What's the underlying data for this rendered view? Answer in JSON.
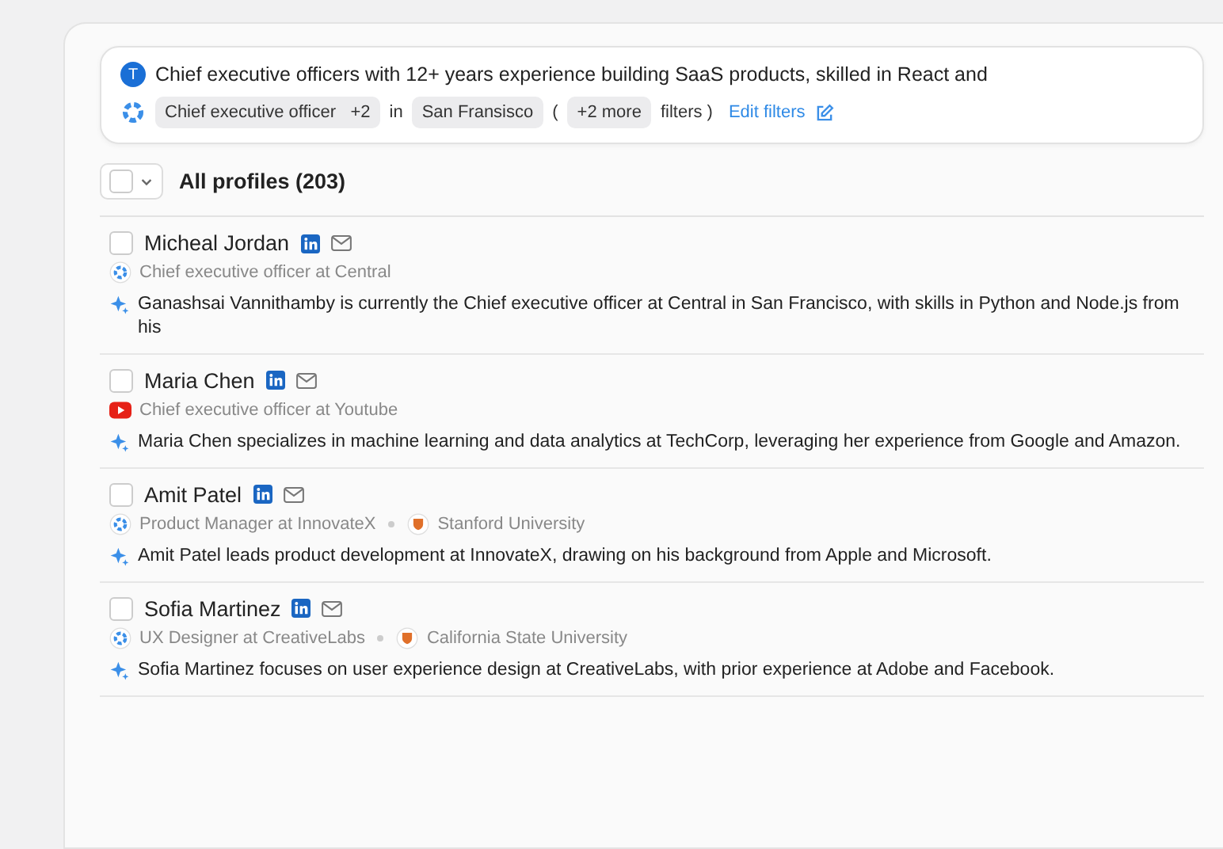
{
  "query": {
    "avatar": "T",
    "text": "Chief executive officers with 12+ years experience building SaaS products, skilled in React and",
    "filters": [
      {
        "kind": "chip",
        "label": "Chief executive officer",
        "extra": "+2"
      },
      {
        "kind": "word",
        "label": "in"
      },
      {
        "kind": "chip",
        "label": "San Fransisco"
      },
      {
        "kind": "word",
        "label": "("
      },
      {
        "kind": "chip",
        "label": "+2 more"
      },
      {
        "kind": "word",
        "label": "filters )"
      }
    ],
    "edit_link": "Edit filters"
  },
  "list_header": {
    "title": "All profiles (203)",
    "checked": false
  },
  "profiles": [
    {
      "name": "Micheal Jordan",
      "checked": false,
      "kind": "gear",
      "title": "Chief executive officer at Central",
      "summary": "Ganashsai Vannithamby is currently the Chief executive officer at Central in San Francisco, with skills in Python and Node.js from his"
    },
    {
      "name": "Maria Chen",
      "checked": false,
      "kind": "play",
      "title": "Chief executive officer at Youtube",
      "summary": "Maria Chen specializes in machine learning and data analytics at TechCorp, leveraging her experience from Google and Amazon."
    },
    {
      "name": "Amit Patel",
      "checked": false,
      "kind": "gear",
      "title": "Product Manager at InnovateX",
      "school": "Stanford University",
      "summary": "Amit Patel leads product development at InnovateX, drawing on his background from Apple and Microsoft."
    },
    {
      "name": "Sofia Martinez",
      "checked": false,
      "kind": "gear",
      "title": "UX Designer at CreativeLabs",
      "school": "California State University",
      "summary": "Sofia Martinez focuses on user experience design at CreativeLabs, with prior experience at Adobe and Facebook."
    }
  ]
}
